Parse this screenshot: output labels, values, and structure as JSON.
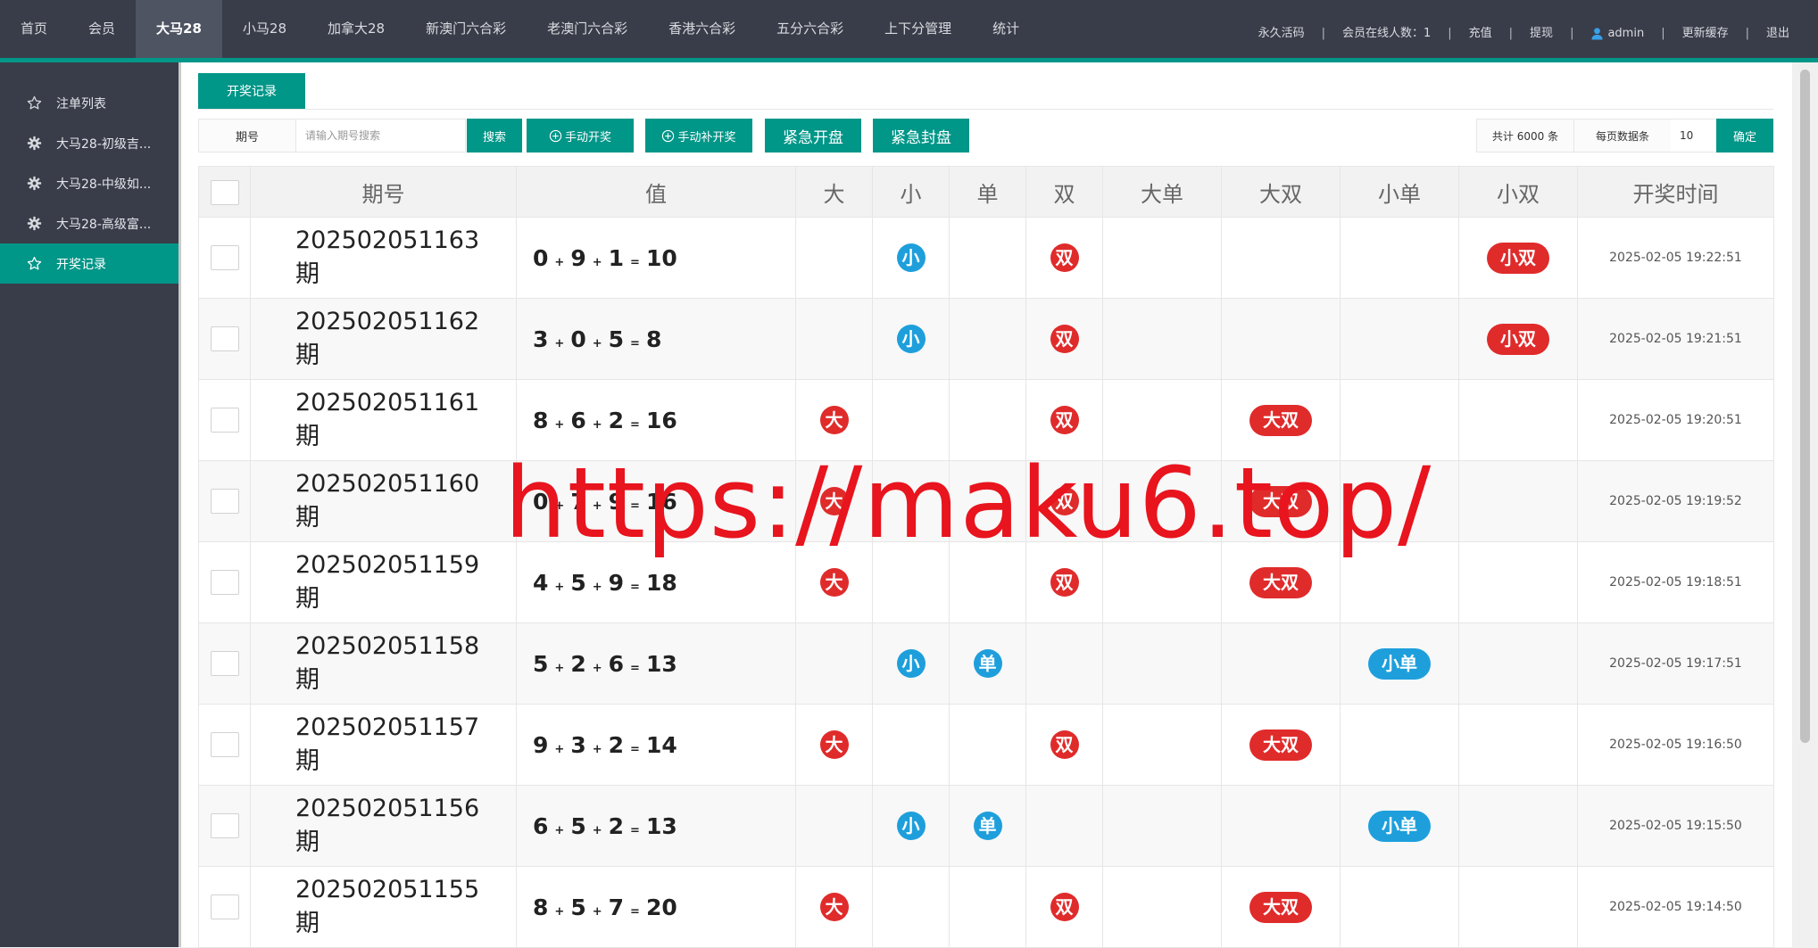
{
  "nav": {
    "items": [
      {
        "label": "首页"
      },
      {
        "label": "会员"
      },
      {
        "label": "大马28",
        "active": true
      },
      {
        "label": "小马28"
      },
      {
        "label": "加拿大28"
      },
      {
        "label": "新澳门六合彩"
      },
      {
        "label": "老澳门六合彩"
      },
      {
        "label": "香港六合彩"
      },
      {
        "label": "五分六合彩"
      },
      {
        "label": "上下分管理"
      },
      {
        "label": "统计"
      }
    ],
    "right": {
      "permanent_code": "永久活码",
      "online_count": "会员在线人数：1",
      "recharge": "充值",
      "withdraw": "提现",
      "user": "admin",
      "clear_cache": "更新缓存",
      "logout": "退出",
      "separator": "|"
    }
  },
  "sidebar": {
    "items": [
      {
        "label": "注单列表",
        "icon": "star-icon"
      },
      {
        "label": "大马28-初级吉...",
        "icon": "gear-icon"
      },
      {
        "label": "大马28-中级如...",
        "icon": "gear-icon"
      },
      {
        "label": "大马28-高级富...",
        "icon": "gear-icon"
      },
      {
        "label": "开奖记录",
        "icon": "star-icon",
        "active": true
      }
    ]
  },
  "tab": {
    "label": "开奖记录"
  },
  "search": {
    "label": "期号",
    "placeholder": "请输入期号搜索",
    "search_btn": "搜索",
    "manual_draw_btn": "手动开奖",
    "manual_supplement_btn": "手动补开奖",
    "emergency_open_btn": "紧急开盘",
    "emergency_close_btn": "紧急封盘"
  },
  "pager": {
    "total": "共计 6000 条",
    "per_page_label": "每页数据条",
    "per_page_value": "10",
    "confirm": "确定"
  },
  "table": {
    "headers": [
      "期号",
      "值",
      "大",
      "小",
      "单",
      "双",
      "大单",
      "大双",
      "小单",
      "小双",
      "开奖时间"
    ],
    "period_suffix": "期",
    "plus": "+",
    "equals": "=",
    "rows": [
      {
        "period": "202502051163",
        "nums": [
          "0",
          "9",
          "1"
        ],
        "sum": "10",
        "da": "",
        "xiao": "小",
        "dan": "",
        "shuang": "双",
        "dadan": "",
        "dashuang": "",
        "xiaodan": "",
        "xiaoshuang": "小双",
        "time": "2025-02-05 19:22:51"
      },
      {
        "period": "202502051162",
        "nums": [
          "3",
          "0",
          "5"
        ],
        "sum": "8",
        "da": "",
        "xiao": "小",
        "dan": "",
        "shuang": "双",
        "dadan": "",
        "dashuang": "",
        "xiaodan": "",
        "xiaoshuang": "小双",
        "time": "2025-02-05 19:21:51"
      },
      {
        "period": "202502051161",
        "nums": [
          "8",
          "6",
          "2"
        ],
        "sum": "16",
        "da": "大",
        "xiao": "",
        "dan": "",
        "shuang": "双",
        "dadan": "",
        "dashuang": "大双",
        "xiaodan": "",
        "xiaoshuang": "",
        "time": "2025-02-05 19:20:51"
      },
      {
        "period": "202502051160",
        "nums": [
          "0",
          "7",
          "9"
        ],
        "sum": "16",
        "da": "大",
        "xiao": "",
        "dan": "",
        "shuang": "双",
        "dadan": "",
        "dashuang": "大双",
        "xiaodan": "",
        "xiaoshuang": "",
        "time": "2025-02-05 19:19:52"
      },
      {
        "period": "202502051159",
        "nums": [
          "4",
          "5",
          "9"
        ],
        "sum": "18",
        "da": "大",
        "xiao": "",
        "dan": "",
        "shuang": "双",
        "dadan": "",
        "dashuang": "大双",
        "xiaodan": "",
        "xiaoshuang": "",
        "time": "2025-02-05 19:18:51"
      },
      {
        "period": "202502051158",
        "nums": [
          "5",
          "2",
          "6"
        ],
        "sum": "13",
        "da": "",
        "xiao": "小",
        "dan": "单",
        "shuang": "",
        "dadan": "",
        "dashuang": "",
        "xiaodan": "小单",
        "xiaoshuang": "",
        "time": "2025-02-05 19:17:51"
      },
      {
        "period": "202502051157",
        "nums": [
          "9",
          "3",
          "2"
        ],
        "sum": "14",
        "da": "大",
        "xiao": "",
        "dan": "",
        "shuang": "双",
        "dadan": "",
        "dashuang": "大双",
        "xiaodan": "",
        "xiaoshuang": "",
        "time": "2025-02-05 19:16:50"
      },
      {
        "period": "202502051156",
        "nums": [
          "6",
          "5",
          "2"
        ],
        "sum": "13",
        "da": "",
        "xiao": "小",
        "dan": "单",
        "shuang": "",
        "dadan": "",
        "dashuang": "",
        "xiaodan": "小单",
        "xiaoshuang": "",
        "time": "2025-02-05 19:15:50"
      },
      {
        "period": "202502051155",
        "nums": [
          "8",
          "5",
          "7"
        ],
        "sum": "20",
        "da": "大",
        "xiao": "",
        "dan": "",
        "shuang": "双",
        "dadan": "",
        "dashuang": "大双",
        "xiaodan": "",
        "xiaoshuang": "",
        "time": "2025-02-05 19:14:50"
      }
    ]
  },
  "watermark": "https://maku6.top/",
  "colors": {
    "topbar": "#393d49",
    "accent": "#009688",
    "badge_red": "#e02b2b",
    "badge_blue": "#1e9fdc",
    "watermark": "#e8141e"
  }
}
